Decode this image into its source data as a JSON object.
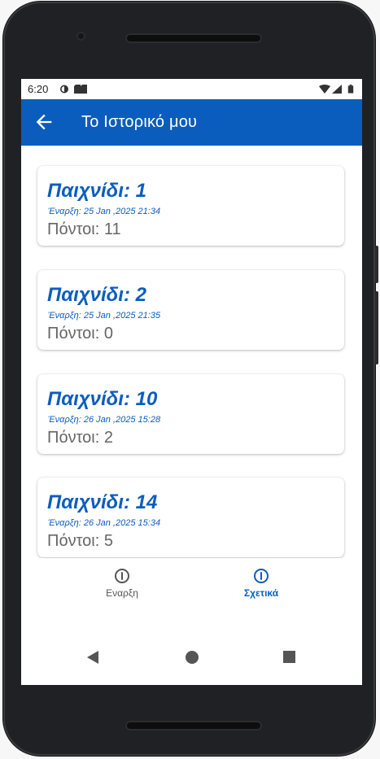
{
  "statusbar": {
    "time": "6:20"
  },
  "appbar": {
    "title": "Το Ιστορικό μου"
  },
  "games": [
    {
      "title": "Παιχνίδι: 1",
      "start": "Έναρξη: 25 Jan ,2025 21:34",
      "points": "Πόντοι: 11"
    },
    {
      "title": "Παιχνίδι: 2",
      "start": "Έναρξη: 25 Jan ,2025 21:35",
      "points": "Πόντοι: 0"
    },
    {
      "title": "Παιχνίδι: 10",
      "start": "Έναρξη: 26 Jan ,2025 15:28",
      "points": "Πόντοι: 2"
    },
    {
      "title": "Παιχνίδι: 14",
      "start": "Έναρξη: 26 Jan ,2025 15:34",
      "points": "Πόντοι: 5"
    }
  ],
  "bottom_nav": {
    "items": [
      {
        "label": "Εναρξη",
        "icon": "info-icon",
        "active": false
      },
      {
        "label": "Σχετικά",
        "icon": "info-icon",
        "active": true
      }
    ]
  },
  "colors": {
    "primary": "#0a5dbd",
    "points_text": "#666666"
  }
}
